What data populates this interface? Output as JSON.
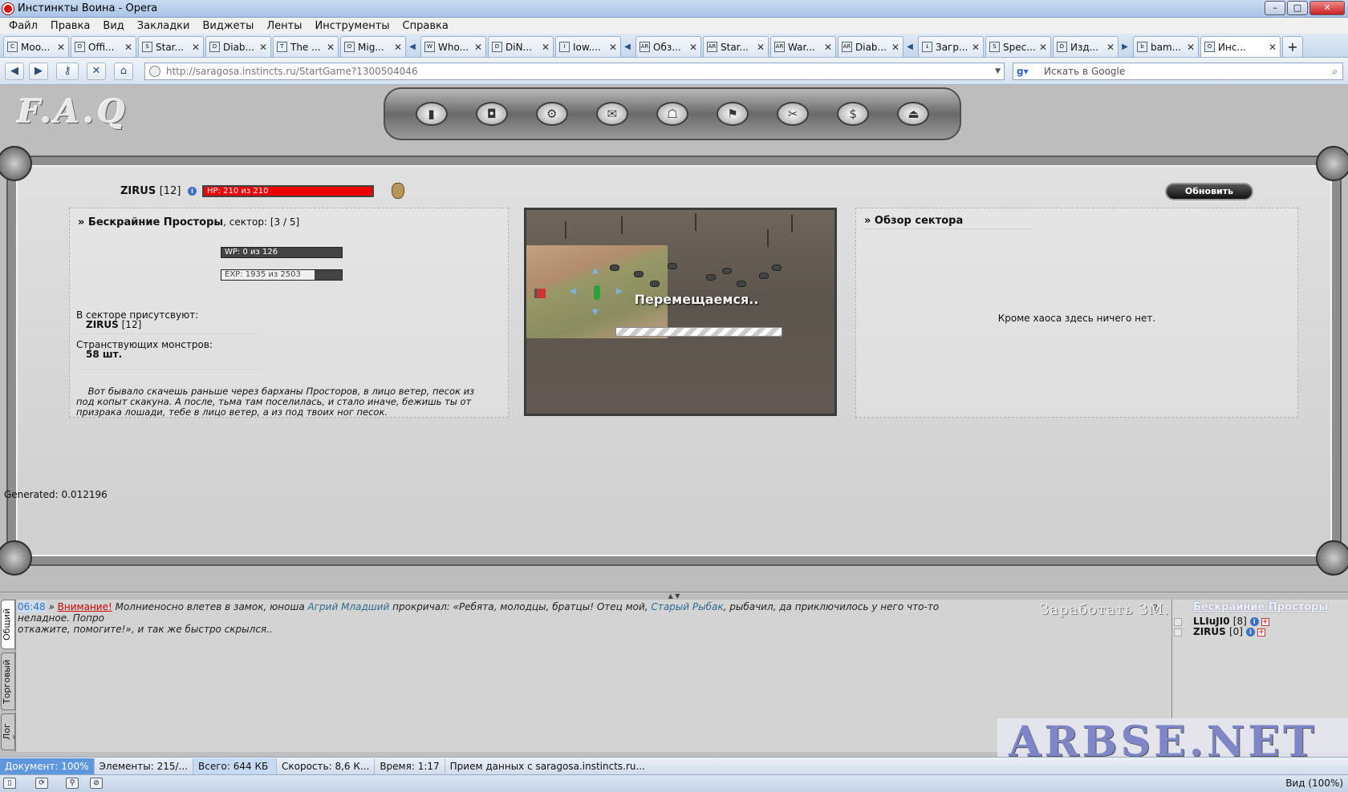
{
  "window": {
    "title": "Инстинкты Воина - Opera"
  },
  "menu": [
    "Файл",
    "Правка",
    "Вид",
    "Закладки",
    "Виджеты",
    "Ленты",
    "Инструменты",
    "Справка"
  ],
  "tabs": [
    {
      "label": "Moo...",
      "icon": "C"
    },
    {
      "label": "Offi...",
      "icon": "D"
    },
    {
      "label": "Star...",
      "icon": "S"
    },
    {
      "label": "Diab...",
      "icon": "D"
    },
    {
      "label": "The ...",
      "icon": "T"
    },
    {
      "label": "Mig...",
      "icon": "O"
    },
    {
      "label": "Who...",
      "icon": "W"
    },
    {
      "label": "DiN...",
      "icon": "D"
    },
    {
      "label": "Iow....",
      "icon": "I"
    },
    {
      "label": "Обз...",
      "icon": "AR"
    },
    {
      "label": "Star...",
      "icon": "AR"
    },
    {
      "label": "War...",
      "icon": "AR"
    },
    {
      "label": "Diab...",
      "icon": "AR"
    },
    {
      "label": "Загр...",
      "icon": "↓"
    },
    {
      "label": "Spec...",
      "icon": "S"
    },
    {
      "label": "Изд...",
      "icon": "D"
    },
    {
      "label": "bam...",
      "icon": "b"
    },
    {
      "label": "Инс...",
      "icon": "O"
    }
  ],
  "nav": {
    "url": "http://saragosa.instincts.ru/StartGame?1300504046",
    "search_placeholder": "Искать в Google"
  },
  "game": {
    "logo": "F.A.Q",
    "player": {
      "name": "ZIRUS",
      "level": "[12]",
      "hp_text": "HP: 210 из 210",
      "hp_fraction": 1.0
    },
    "refresh_label": "Обновить",
    "location": {
      "name": "» Бескрайние Просторы",
      "sector_label": ", сектор: ",
      "sector": "[3 / 5]"
    },
    "wp": {
      "text": "WP: 0 из 126",
      "fraction": 0.0
    },
    "exp": {
      "text": "EXP: 1935 из 2503",
      "fraction": 0.773
    },
    "present_label": "В секторе присутсвуют:",
    "present_player": "ZIRUS",
    "present_level": "[12]",
    "monsters_label": "Странствующих монстров:",
    "monsters_count": "58 шт.",
    "story": "Вот бывало скачешь раньше через барханы Просторов, в лицо ветер, песок из под копыт скакуна. А после, тьма там поселилась, и стало иначе, бежишь ты от призрака лошади, тебе в лицо ветер, а из под твоих ног песок.",
    "moving_text": "Перемещаемся..",
    "sector_overview_title": "» Обзор сектора",
    "sector_empty": "Кроме хаоса здесь ничего нет.",
    "generated": "Generated: 0.012196"
  },
  "chat": {
    "tabs": [
      "Общий",
      "Торговый",
      "Лог боя"
    ],
    "time": "06:48",
    "sep": "»",
    "warning": "Внимание!",
    "t1": "Молниеносно влетев в замок, юноша",
    "npc1": "Агрий Младший",
    "t2": "прокричал: «Ребята, молодцы, братцы! Отец мой,",
    "npc2": "Старый Рыбак",
    "t3": ", рыбачил, да приключилось у него что-то неладное. Попро",
    "t4": "откажите, помогите!», и так же быстро скрылся..",
    "earn": "Заработать ЗМ.",
    "earn_q": "?",
    "users_location": "Бескрайние Просторы",
    "users": [
      {
        "name": "LLIuJI0",
        "level": "[8]"
      },
      {
        "name": "ZIRUS",
        "level": "[0]"
      }
    ]
  },
  "watermark": "ARBSE.NET",
  "status": {
    "document": "Документ:",
    "document_val": "100%",
    "elements": "Элементы:",
    "elements_val": "215/...",
    "total": "Всего:",
    "total_val": "644 КБ",
    "speed": "Скорость:",
    "speed_val": "8,6 К...",
    "time": "Время:",
    "time_val": "1:17",
    "message": "Прием данных с saragosa.instincts.ru...",
    "zoom": "Вид (100%)"
  }
}
